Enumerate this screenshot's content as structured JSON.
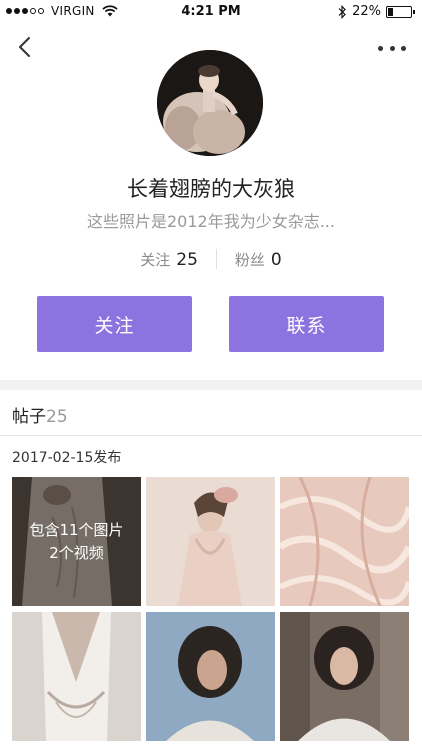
{
  "status_bar": {
    "carrier": "VIRGIN",
    "time": "4:21 PM",
    "battery_text": "22%",
    "battery_level": 0.22,
    "signal_bars_filled": 3,
    "signal_bars_total": 5
  },
  "nav": {
    "back_icon": "chevron-left-icon",
    "more_icon": "more-dots-icon"
  },
  "profile": {
    "name": "长着翅膀的大灰狼",
    "bio": "这些照片是2012年我为少女杂志...",
    "stats": [
      {
        "label": "关注",
        "value": "25"
      },
      {
        "label": "粉丝",
        "value": "0"
      }
    ]
  },
  "actions": {
    "follow_label": "关注",
    "contact_label": "联系"
  },
  "posts": {
    "title": "帖子",
    "count": "25",
    "date": "2017-02-15发布",
    "overlay_line1": "包含11个图片",
    "overlay_line2": "2个视频"
  },
  "colors": {
    "accent": "#8c73e0",
    "muted_text": "#9a9a9a",
    "divider": "#f2f2f4"
  }
}
